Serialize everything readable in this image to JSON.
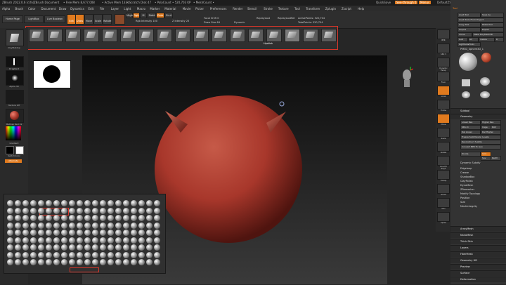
{
  "titlebar": {
    "app": "ZBrush 2022.0.6 [d.fo]",
    "doc": "ZBrush Document",
    "freemem": "• Free Mem 8,677,008",
    "activemem": "• Active Mem 1321",
    "scratch": "• Scratch Disk 47",
    "polycount": "• PolyCount • 520,703 KP",
    "meshcount": "• MeshCount •",
    "quicksave": "QuickSave",
    "seethrough": "See-through 0",
    "menus_btn": "Menus",
    "script": "DefaultZScript"
  },
  "menubar": [
    "Alpha",
    "Brush",
    "Color",
    "Document",
    "Draw",
    "Dynamics",
    "Edit",
    "File",
    "Layer",
    "Light",
    "Macro",
    "Marker",
    "Material",
    "Movie",
    "Picker",
    "Preferences",
    "Render",
    "Stencil",
    "Stroke",
    "Texture",
    "Tool",
    "Transform",
    "Zplugin",
    "Zscript",
    "Help"
  ],
  "shelf": {
    "homepage": "Home Page",
    "lightbox": "LightBox",
    "liveboolean": "Live Boolean",
    "edit": "Edit",
    "draw": "Draw",
    "move": "Move",
    "scale": "Scale",
    "rotate": "Rotate",
    "mrgb": "Mrgb",
    "rgb": "Rgb",
    "m": "M",
    "zadd": "Zadd",
    "zsub": "Zsub",
    "zcut": "Zcut",
    "rgb_intensity": "Rgb Intensity 100",
    "z_intensity": "Z Intensity 25",
    "focal_shift": "Focal Shift 0",
    "draw_size": "Draw Size 64",
    "dynamic": "Dynamic",
    "active_points": "ActivePoints: 520,704",
    "total_points": "TotalPoints: 520,704",
    "replay_last": "ReplayLast",
    "replay_lastrel": "ReplayLastRel"
  },
  "brush_palette": {
    "tooltip": "Hpolish",
    "items": [
      "ClayBuildup",
      "Standard",
      "Move",
      "DamStandard",
      "hPolish",
      "TrimDynamic",
      "Inflate",
      "Pinch",
      "Smooth",
      "Flatten",
      "MoveTopological",
      "SnakeHook",
      "ClayTubes",
      "Planar",
      "Hpolish",
      "TrimAdaptive",
      "Polish"
    ]
  },
  "left_tray": {
    "brush_label": "ClayBuildup",
    "stroke_label": "DragRect",
    "alpha_label": "Alpha 39",
    "texture_label": "Texture Off",
    "material_label": "MatCap Red 01",
    "gradient_label": "Gradient",
    "switch_label": "SwitchColor",
    "alternate_label": "Alternate"
  },
  "right_shelf": [
    "BPR",
    "SPix 3",
    "Dynamic Persp",
    "Floor",
    "Local",
    "Frame",
    "Move",
    "Scale",
    "Rotate",
    "Line Fill PolyF",
    "Transp",
    "Ghost",
    "Solo",
    "Xpose"
  ],
  "right_panel": {
    "tool_title": "Tool",
    "load_tool": "Load Tool",
    "save_as": "Save As",
    "load_tools_from_project": "Load Tools From Project",
    "copy_tool": "Copy Tool",
    "paste_tool": "Paste Tool",
    "import": "Import",
    "export": "Export",
    "clone": "Clone",
    "make_polymesh": "Make PolyMesh3D",
    "goz": "GoZ",
    "all": "All",
    "visible": "Visible",
    "r": "R",
    "lightbox_tools": "Lightbox▸Tools",
    "current_tool": "PM3D_Sphere3D_1",
    "tools": [
      "PM3D_Sphere3D_1",
      "PM3D_Sphere3D",
      "SimpleBrush",
      "EraserBrush",
      "PM3D_Sphere3D_1",
      "PM3D_Sphere3D_2"
    ],
    "subtool": "Subtool",
    "geometry": "Geometry",
    "lower_res": "Lower Res",
    "higher_res": "Higher Res",
    "sdiv": "SDiv 4",
    "cage": "Cage",
    "rstr": "Rstr",
    "del_lower": "Del Lower",
    "del_higher": "Del Higher",
    "freeze_subdiv": "Freeze SubDivision Levels",
    "reconstruct_subdiv": "Reconstruct Subdiv",
    "convert_bpr": "Convert BPR To Geo",
    "divide": "Divide",
    "smt": "Smt",
    "suv": "Suv",
    "reuv": "ReUV",
    "dynamic_subdiv": "Dynamic Subdiv",
    "sections": [
      "Edgeloop",
      "Crease",
      "ShadowBox",
      "ClayPolish",
      "DynaMesh",
      "ZRemesher",
      "Modify Topology",
      "Position",
      "Size",
      "MeshIntegrity"
    ],
    "bottom_sections": [
      "ArrayMesh",
      "NanoMesh",
      "Thick Skin",
      "Layers",
      "FiberMesh",
      "Geometry HD",
      "Preview",
      "Surface",
      "Deformation"
    ]
  },
  "colors": {
    "accent": "#e07a1e",
    "highlight_box": "#d8362a",
    "sphere": "#a8372b",
    "canvas_top": "#0b0b0b"
  }
}
